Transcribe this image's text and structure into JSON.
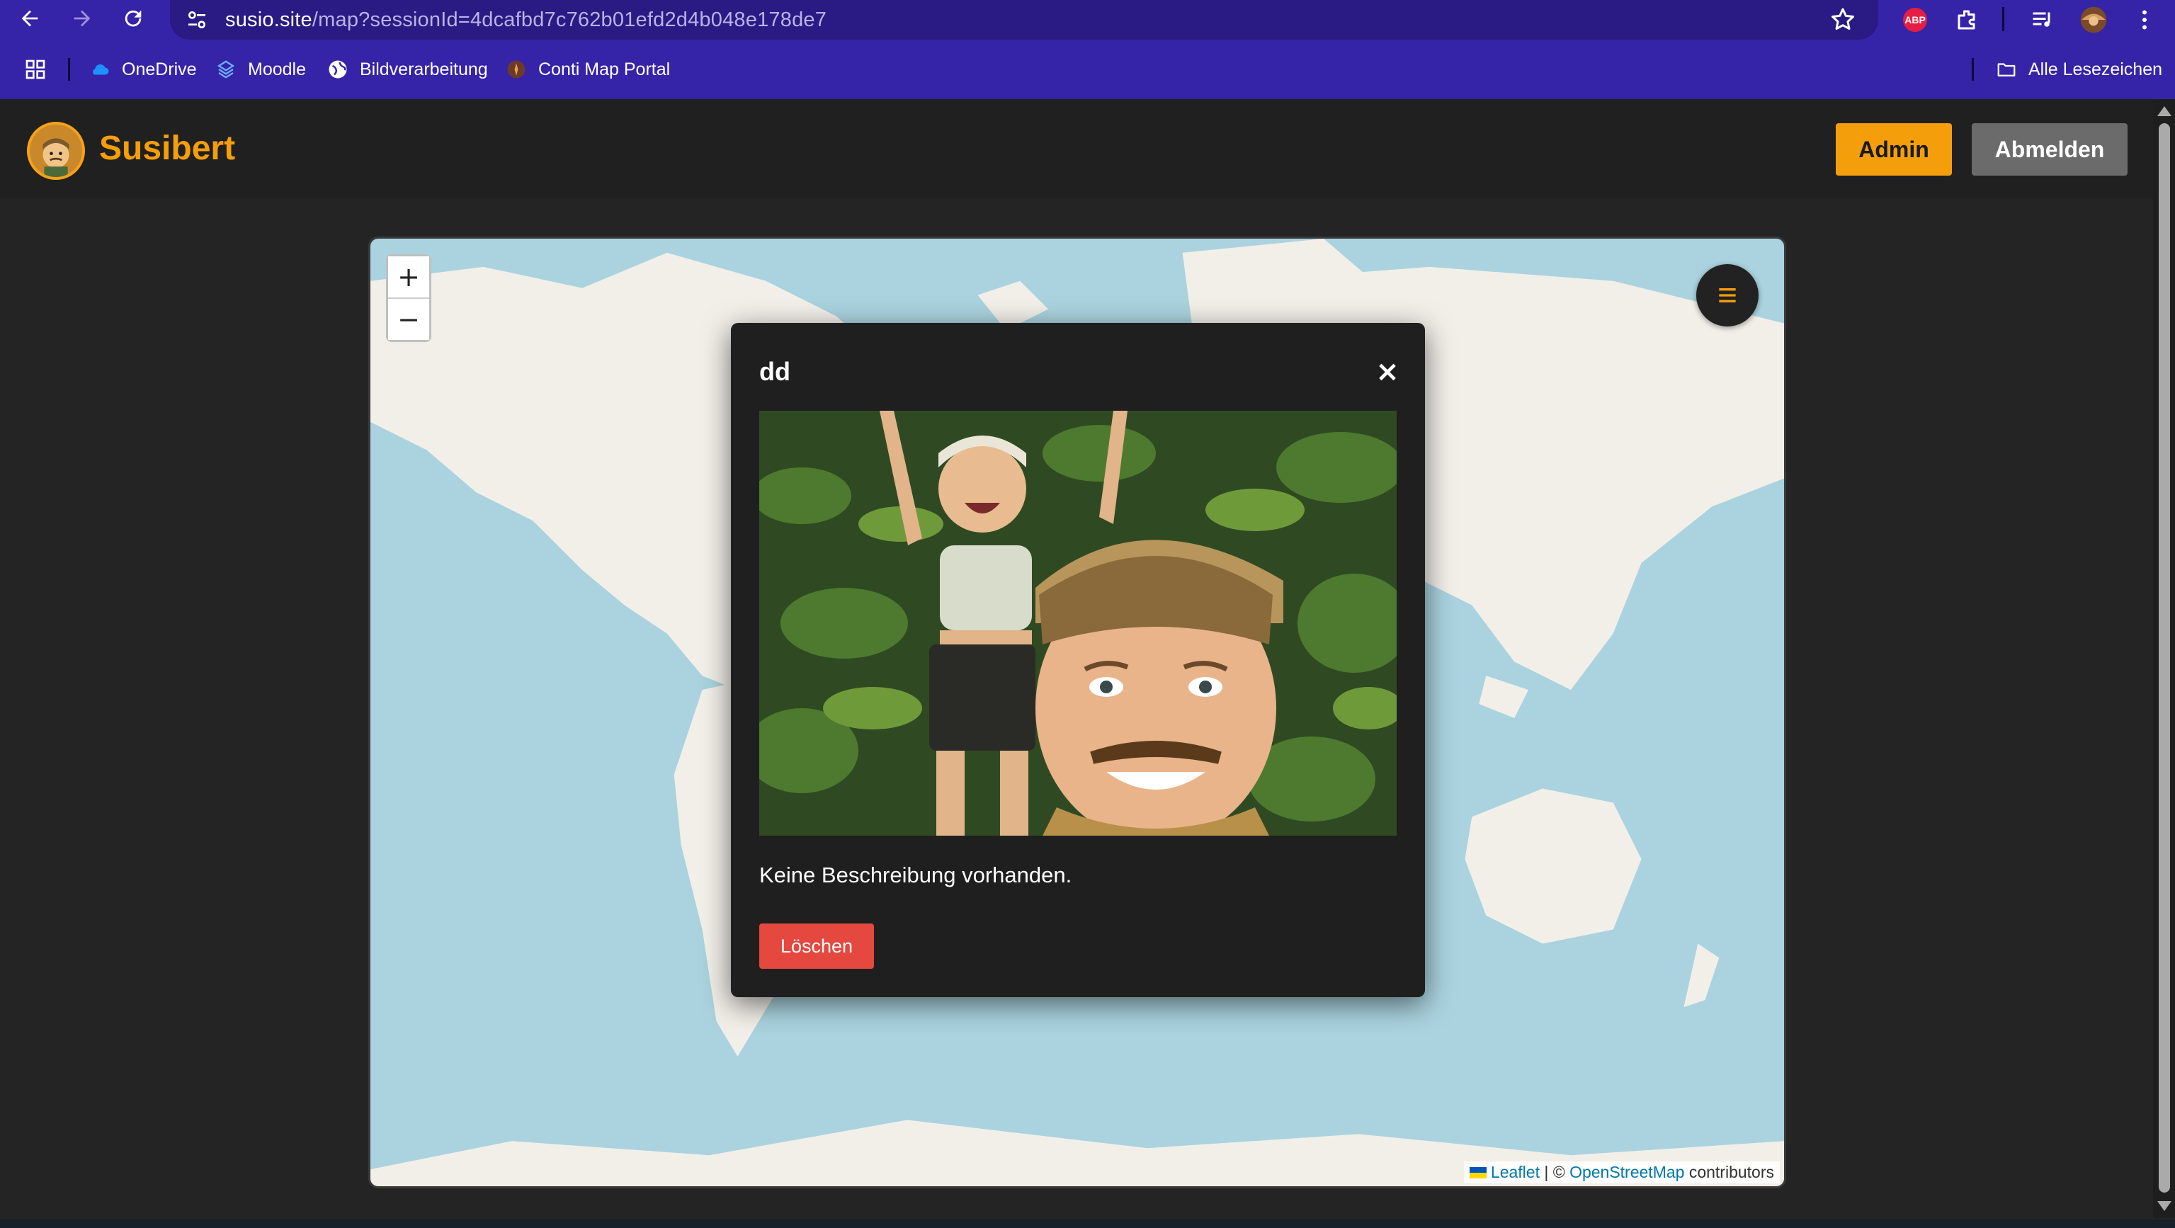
{
  "browser": {
    "url_host": "susio.site",
    "url_path": "/map?sessionId=4dcafbd7c762b01efd2d4b048e178de7",
    "extensions": {
      "abp_label": "ABP"
    },
    "bookmarks": [
      {
        "label": "OneDrive",
        "icon": "cloud-icon"
      },
      {
        "label": "Moodle",
        "icon": "moodle-icon"
      },
      {
        "label": "Bildverarbeitung",
        "icon": "globe-icon"
      },
      {
        "label": "Conti Map Portal",
        "icon": "portal-icon"
      }
    ],
    "all_bookmarks_label": "Alle Lesezeichen"
  },
  "header": {
    "brand": "Susibert",
    "admin_label": "Admin",
    "logout_label": "Abmelden",
    "accent_color": "#f59e0b"
  },
  "map": {
    "zoom_in_label": "+",
    "zoom_out_label": "−",
    "attribution": {
      "leaflet": "Leaflet",
      "separator": " | © ",
      "osm": "OpenStreetMap",
      "suffix": " contributors"
    }
  },
  "modal": {
    "title": "dd",
    "close_label": "×",
    "description": "Keine Beschreibung vorhanden.",
    "delete_label": "Löschen",
    "delete_color": "#e5483f"
  }
}
